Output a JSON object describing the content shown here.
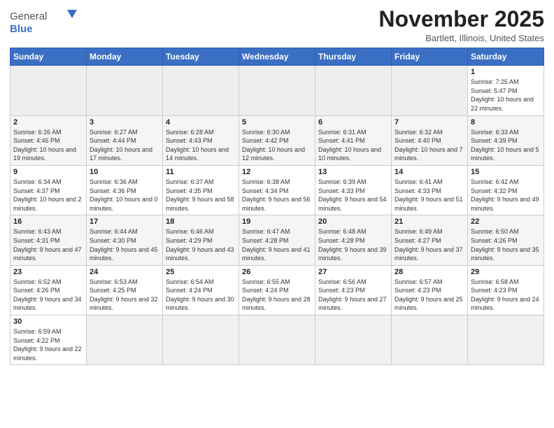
{
  "header": {
    "logo_general": "General",
    "logo_blue": "Blue",
    "month_title": "November 2025",
    "location": "Bartlett, Illinois, United States"
  },
  "days_of_week": [
    "Sunday",
    "Monday",
    "Tuesday",
    "Wednesday",
    "Thursday",
    "Friday",
    "Saturday"
  ],
  "weeks": [
    [
      {
        "day": "",
        "empty": true
      },
      {
        "day": "",
        "empty": true
      },
      {
        "day": "",
        "empty": true
      },
      {
        "day": "",
        "empty": true
      },
      {
        "day": "",
        "empty": true
      },
      {
        "day": "",
        "empty": true
      },
      {
        "day": "1",
        "sunrise": "7:25 AM",
        "sunset": "5:47 PM",
        "daylight": "10 hours and 22 minutes."
      }
    ],
    [
      {
        "day": "2",
        "sunrise": "6:26 AM",
        "sunset": "4:46 PM",
        "daylight": "10 hours and 19 minutes."
      },
      {
        "day": "3",
        "sunrise": "6:27 AM",
        "sunset": "4:44 PM",
        "daylight": "10 hours and 17 minutes."
      },
      {
        "day": "4",
        "sunrise": "6:28 AM",
        "sunset": "4:43 PM",
        "daylight": "10 hours and 14 minutes."
      },
      {
        "day": "5",
        "sunrise": "6:30 AM",
        "sunset": "4:42 PM",
        "daylight": "10 hours and 12 minutes."
      },
      {
        "day": "6",
        "sunrise": "6:31 AM",
        "sunset": "4:41 PM",
        "daylight": "10 hours and 10 minutes."
      },
      {
        "day": "7",
        "sunrise": "6:32 AM",
        "sunset": "4:40 PM",
        "daylight": "10 hours and 7 minutes."
      },
      {
        "day": "8",
        "sunrise": "6:33 AM",
        "sunset": "4:39 PM",
        "daylight": "10 hours and 5 minutes."
      }
    ],
    [
      {
        "day": "9",
        "sunrise": "6:34 AM",
        "sunset": "4:37 PM",
        "daylight": "10 hours and 2 minutes."
      },
      {
        "day": "10",
        "sunrise": "6:36 AM",
        "sunset": "4:36 PM",
        "daylight": "10 hours and 0 minutes."
      },
      {
        "day": "11",
        "sunrise": "6:37 AM",
        "sunset": "4:35 PM",
        "daylight": "9 hours and 58 minutes."
      },
      {
        "day": "12",
        "sunrise": "6:38 AM",
        "sunset": "4:34 PM",
        "daylight": "9 hours and 56 minutes."
      },
      {
        "day": "13",
        "sunrise": "6:39 AM",
        "sunset": "4:33 PM",
        "daylight": "9 hours and 54 minutes."
      },
      {
        "day": "14",
        "sunrise": "6:41 AM",
        "sunset": "4:33 PM",
        "daylight": "9 hours and 51 minutes."
      },
      {
        "day": "15",
        "sunrise": "6:42 AM",
        "sunset": "4:32 PM",
        "daylight": "9 hours and 49 minutes."
      }
    ],
    [
      {
        "day": "16",
        "sunrise": "6:43 AM",
        "sunset": "4:31 PM",
        "daylight": "9 hours and 47 minutes."
      },
      {
        "day": "17",
        "sunrise": "6:44 AM",
        "sunset": "4:30 PM",
        "daylight": "9 hours and 45 minutes."
      },
      {
        "day": "18",
        "sunrise": "6:46 AM",
        "sunset": "4:29 PM",
        "daylight": "9 hours and 43 minutes."
      },
      {
        "day": "19",
        "sunrise": "6:47 AM",
        "sunset": "4:28 PM",
        "daylight": "9 hours and 41 minutes."
      },
      {
        "day": "20",
        "sunrise": "6:48 AM",
        "sunset": "4:28 PM",
        "daylight": "9 hours and 39 minutes."
      },
      {
        "day": "21",
        "sunrise": "6:49 AM",
        "sunset": "4:27 PM",
        "daylight": "9 hours and 37 minutes."
      },
      {
        "day": "22",
        "sunrise": "6:50 AM",
        "sunset": "4:26 PM",
        "daylight": "9 hours and 35 minutes."
      }
    ],
    [
      {
        "day": "23",
        "sunrise": "6:52 AM",
        "sunset": "4:26 PM",
        "daylight": "9 hours and 34 minutes."
      },
      {
        "day": "24",
        "sunrise": "6:53 AM",
        "sunset": "4:25 PM",
        "daylight": "9 hours and 32 minutes."
      },
      {
        "day": "25",
        "sunrise": "6:54 AM",
        "sunset": "4:24 PM",
        "daylight": "9 hours and 30 minutes."
      },
      {
        "day": "26",
        "sunrise": "6:55 AM",
        "sunset": "4:24 PM",
        "daylight": "9 hours and 28 minutes."
      },
      {
        "day": "27",
        "sunrise": "6:56 AM",
        "sunset": "4:23 PM",
        "daylight": "9 hours and 27 minutes."
      },
      {
        "day": "28",
        "sunrise": "6:57 AM",
        "sunset": "4:23 PM",
        "daylight": "9 hours and 25 minutes."
      },
      {
        "day": "29",
        "sunrise": "6:58 AM",
        "sunset": "4:23 PM",
        "daylight": "9 hours and 24 minutes."
      }
    ],
    [
      {
        "day": "30",
        "sunrise": "6:59 AM",
        "sunset": "4:22 PM",
        "daylight": "9 hours and 22 minutes."
      },
      {
        "day": "",
        "empty": true
      },
      {
        "day": "",
        "empty": true
      },
      {
        "day": "",
        "empty": true
      },
      {
        "day": "",
        "empty": true
      },
      {
        "day": "",
        "empty": true
      },
      {
        "day": "",
        "empty": true
      }
    ]
  ]
}
